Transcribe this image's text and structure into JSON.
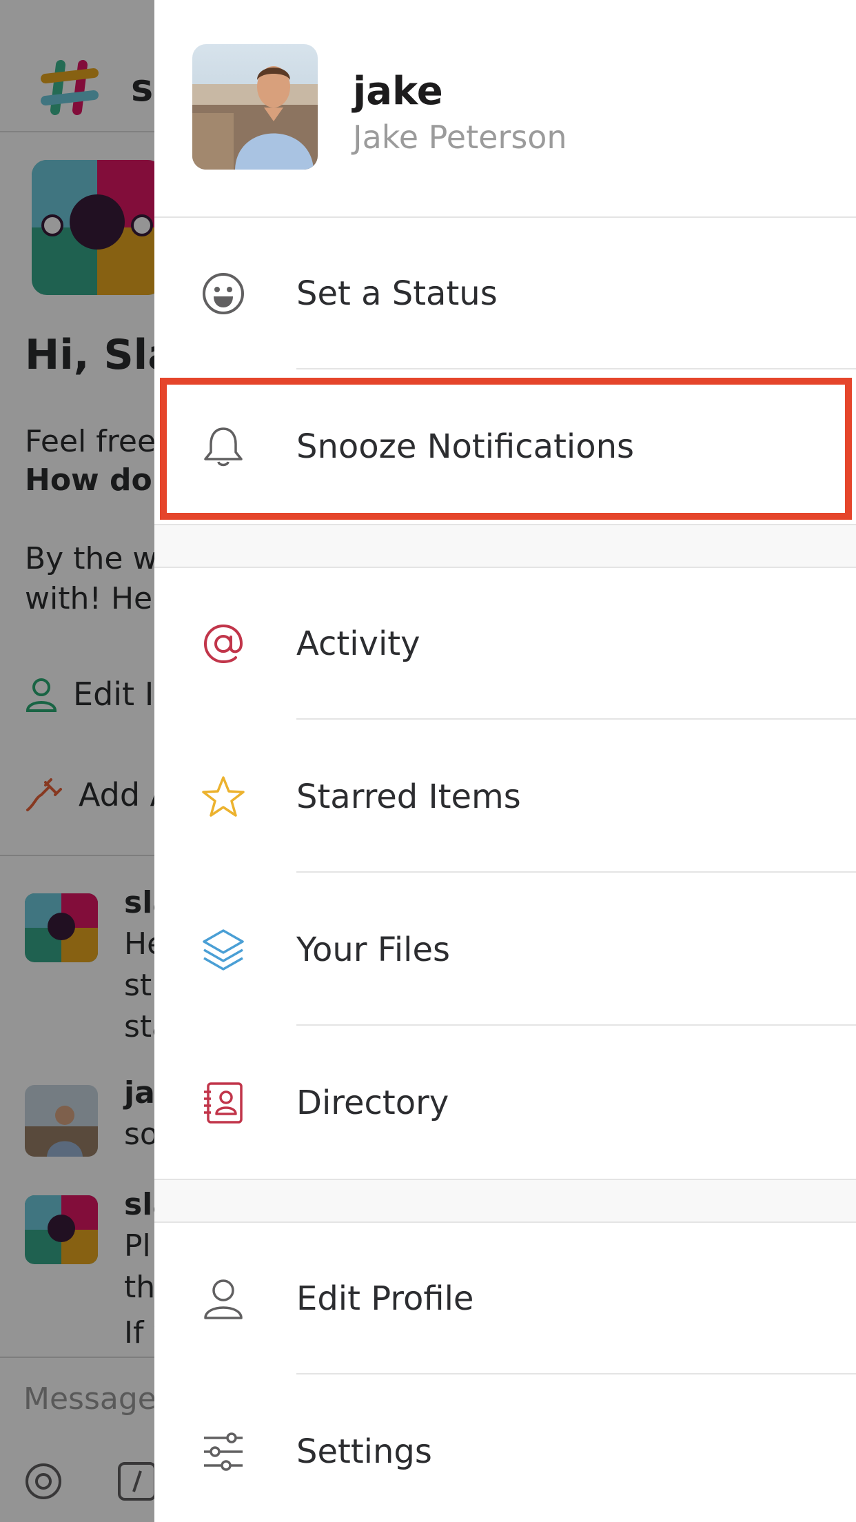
{
  "background": {
    "team_name_partial": "sl",
    "intro_heading": "Hi, Sla",
    "intro_line1": "Feel free",
    "intro_line2": "How do I",
    "intro_line3": "By the wa",
    "intro_line4": "with! Her",
    "action_edit_profile": "Edit I",
    "action_add_apps": "Add A",
    "messages": [
      {
        "name": "sla",
        "lines": [
          "He",
          "sti",
          "sta"
        ]
      },
      {
        "name": "jal",
        "lines": [
          "so"
        ]
      },
      {
        "name": "sla",
        "lines": [
          "Pl",
          "th",
          "If v"
        ]
      }
    ],
    "composer_placeholder": "Message"
  },
  "drawer": {
    "profile": {
      "username": "jake",
      "full_name": "Jake Peterson"
    },
    "section1": [
      {
        "label": "Set a Status",
        "icon": "smiley-icon",
        "color": "#616061"
      },
      {
        "label": "Snooze Notifications",
        "icon": "bell-icon",
        "color": "#616061",
        "highlighted": true
      }
    ],
    "section2": [
      {
        "label": "Activity",
        "icon": "at-sign-icon",
        "color": "#c1354a"
      },
      {
        "label": "Starred Items",
        "icon": "star-icon",
        "color": "#ecb22e"
      },
      {
        "label": "Your Files",
        "icon": "layers-icon",
        "color": "#4a9fd5"
      },
      {
        "label": "Directory",
        "icon": "directory-icon",
        "color": "#c1354a"
      }
    ],
    "section3": [
      {
        "label": "Edit Profile",
        "icon": "person-icon",
        "color": "#616061"
      },
      {
        "label": "Settings",
        "icon": "sliders-icon",
        "color": "#616061"
      }
    ]
  },
  "colors": {
    "highlight": "#e5452b",
    "accent_red": "#c1354a",
    "accent_yellow": "#ecb22e",
    "accent_blue": "#4a9fd5"
  }
}
